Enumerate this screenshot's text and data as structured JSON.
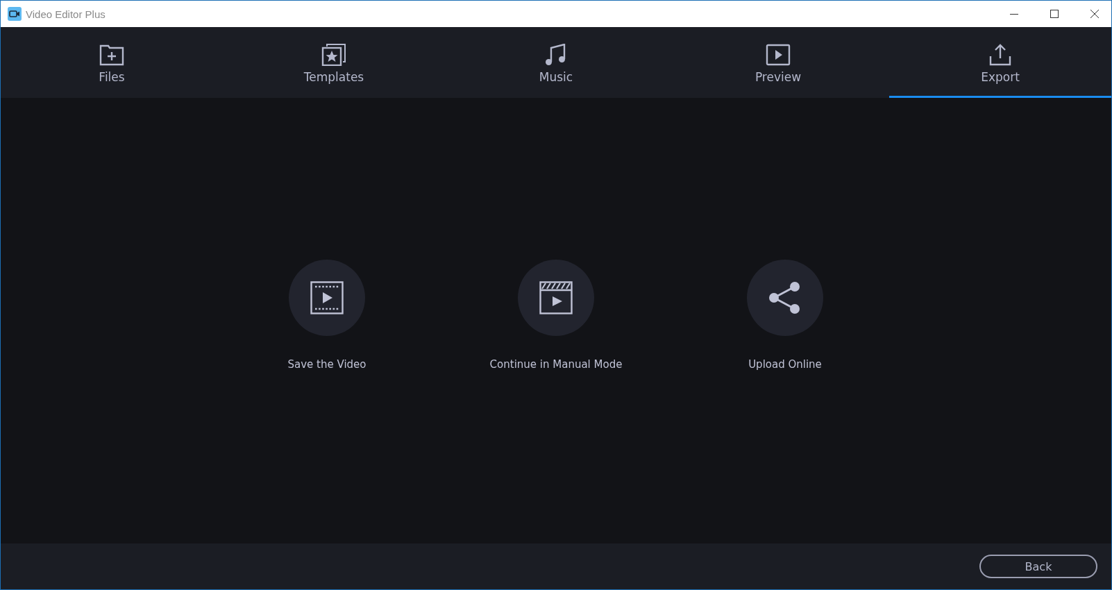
{
  "window": {
    "title": "Video Editor Plus"
  },
  "tabs": [
    {
      "kind": "files",
      "label": "Files",
      "selected": false
    },
    {
      "kind": "templates",
      "label": "Templates",
      "selected": false
    },
    {
      "kind": "music",
      "label": "Music",
      "selected": false
    },
    {
      "kind": "preview",
      "label": "Preview",
      "selected": false
    },
    {
      "kind": "export",
      "label": "Export",
      "selected": true
    }
  ],
  "actions": [
    {
      "kind": "save",
      "label": "Save the Video"
    },
    {
      "kind": "manual",
      "label": "Continue in Manual Mode"
    },
    {
      "kind": "upload",
      "label": "Upload Online"
    }
  ],
  "footer": {
    "back_button": "Back"
  }
}
